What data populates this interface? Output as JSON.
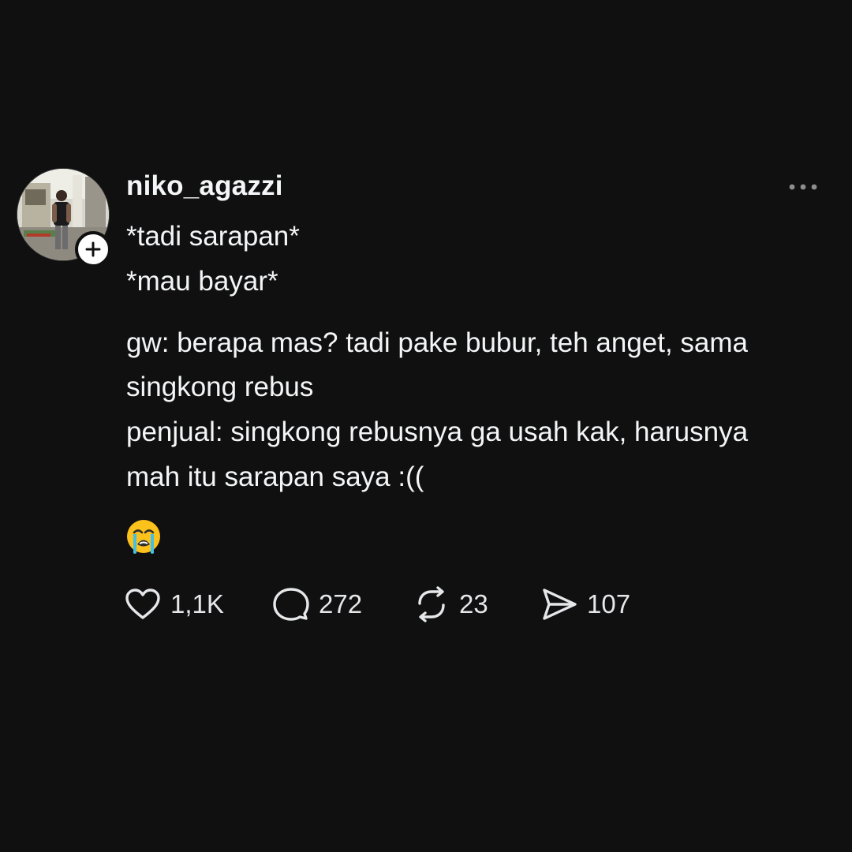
{
  "post": {
    "username": "niko_agazzi",
    "avatar_icon": "profile-photo",
    "follow_icon": "plus-icon",
    "more_icon": "more-horizontal-icon",
    "lines": [
      "*tadi sarapan*",
      "*mau bayar*",
      "gw: berapa mas? tadi pake bubur, teh anget, sama",
      "singkong rebus",
      "penjual: singkong rebusnya ga usah kak, harusnya",
      "mah itu sarapan saya :(("
    ],
    "emoji": "loudly-crying-face-emoji"
  },
  "actions": {
    "like": {
      "icon": "heart-icon",
      "count": "1,1K"
    },
    "reply": {
      "icon": "comment-bubble-icon",
      "count": "272"
    },
    "repost": {
      "icon": "repost-icon",
      "count": "23"
    },
    "share": {
      "icon": "send-icon",
      "count": "107"
    }
  },
  "colors": {
    "background": "#101010",
    "text": "#f3f5f7",
    "muted": "#8e8e8e"
  }
}
